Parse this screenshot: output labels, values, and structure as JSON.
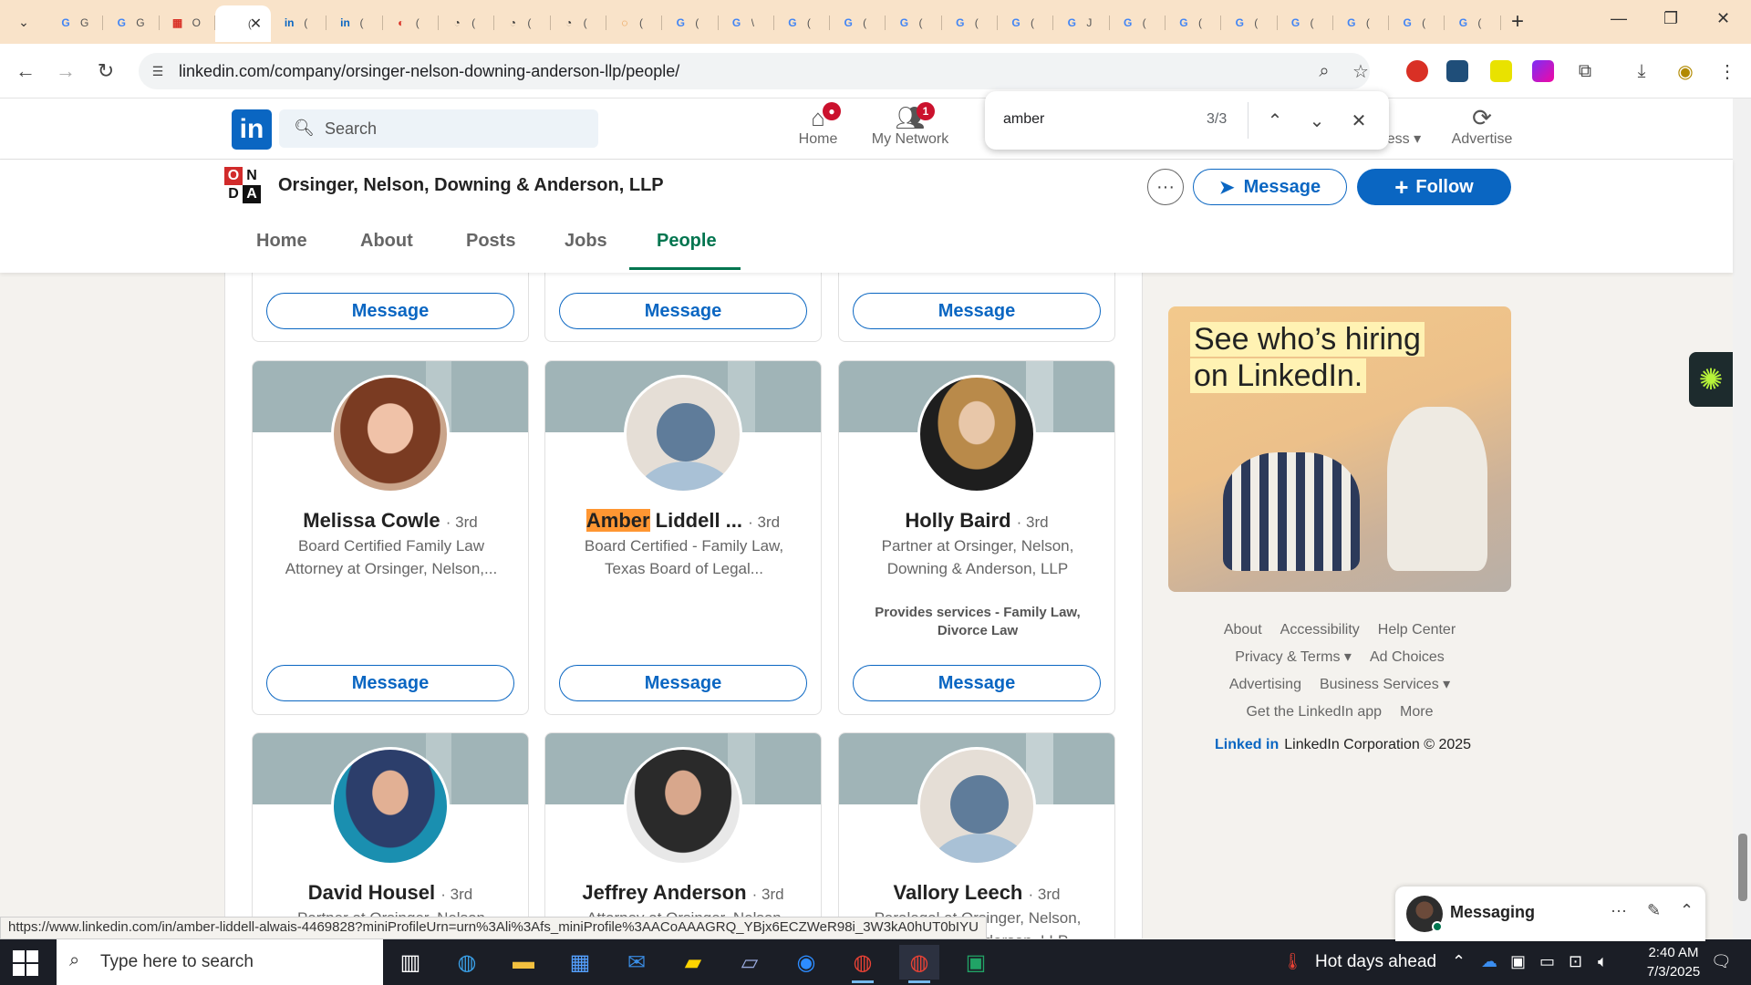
{
  "browser": {
    "tabs": [
      {
        "fav": "G",
        "color": "#4285f4",
        "label": "G"
      },
      {
        "fav": "G",
        "color": "#4285f4",
        "label": "G"
      },
      {
        "fav": "▦",
        "color": "#d93025",
        "label": "O"
      },
      {
        "fav": "",
        "color": "#888888",
        "label": "(",
        "active": true
      },
      {
        "fav": "in",
        "color": "#0a66c2",
        "label": "("
      },
      {
        "fav": "in",
        "color": "#0a66c2",
        "label": "("
      },
      {
        "fav": "◐",
        "color": "#d93025",
        "label": "("
      },
      {
        "fav": "◔",
        "color": "#333333",
        "label": "("
      },
      {
        "fav": "◔",
        "color": "#333333",
        "label": "("
      },
      {
        "fav": "◔",
        "color": "#333333",
        "label": "("
      },
      {
        "fav": "◌",
        "color": "#e37400",
        "label": "("
      },
      {
        "fav": "G",
        "color": "#4285f4",
        "label": "("
      },
      {
        "fav": "G",
        "color": "#4285f4",
        "label": "\\"
      },
      {
        "fav": "G",
        "color": "#4285f4",
        "label": "("
      },
      {
        "fav": "G",
        "color": "#4285f4",
        "label": "("
      },
      {
        "fav": "G",
        "color": "#4285f4",
        "label": "("
      },
      {
        "fav": "G",
        "color": "#4285f4",
        "label": "("
      },
      {
        "fav": "G",
        "color": "#4285f4",
        "label": "("
      },
      {
        "fav": "G",
        "color": "#4285f4",
        "label": "J"
      },
      {
        "fav": "G",
        "color": "#4285f4",
        "label": "("
      },
      {
        "fav": "G",
        "color": "#4285f4",
        "label": "("
      },
      {
        "fav": "G",
        "color": "#4285f4",
        "label": "("
      },
      {
        "fav": "G",
        "color": "#4285f4",
        "label": "("
      },
      {
        "fav": "G",
        "color": "#4285f4",
        "label": "("
      },
      {
        "fav": "G",
        "color": "#4285f4",
        "label": "("
      },
      {
        "fav": "G",
        "color": "#4285f4",
        "label": "("
      }
    ],
    "url": "linkedin.com/company/orsinger-nelson-downing-anderson-llp/people/"
  },
  "find": {
    "query": "amber",
    "count": "3/3"
  },
  "linkedin": {
    "logo": "in",
    "search_placeholder": "Search",
    "nav": [
      {
        "label": "Home",
        "icon": "⌂",
        "badge": "●"
      },
      {
        "label": "My Network",
        "icon": "👥",
        "badge": "1"
      }
    ],
    "nav_partial": [
      "ness ▾",
      "Advertise"
    ]
  },
  "company": {
    "logo_letters": [
      "O",
      "N",
      "D",
      "A"
    ],
    "name": "Orsinger, Nelson, Downing & Anderson, LLP",
    "message_label": "Message",
    "follow_label": "Follow",
    "tabs": [
      "Home",
      "About",
      "Posts",
      "Jobs",
      "People"
    ],
    "active_tab": "People"
  },
  "people": {
    "message_label": "Message",
    "top_row_messages": [
      "Message",
      "Message",
      "Message"
    ],
    "row1": [
      {
        "name": "Melissa Cowle",
        "degree": "· 3rd",
        "headline_1": "Board Certified Family Law",
        "headline_2": "Attorney at Orsinger, Nelson,...",
        "services": ""
      },
      {
        "name_hl": "Amber",
        "name_rest": " Liddell ...",
        "degree": "· 3rd",
        "headline_1": "Board Certified - Family Law,",
        "headline_2": "Texas Board of Legal...",
        "services": ""
      },
      {
        "name": "Holly Baird",
        "degree": "· 3rd",
        "headline_1": "Partner at Orsinger, Nelson,",
        "headline_2": "Downing & Anderson, LLP",
        "services": "Provides services - Family Law, Divorce Law"
      }
    ],
    "row2": [
      {
        "name": "David Housel",
        "degree": "· 3rd",
        "headline_1": "Partner at Orsinger, Nelson"
      },
      {
        "name": "Jeffrey Anderson",
        "degree": "· 3rd",
        "headline_1": "Attorney at Orsinger, Nelson"
      },
      {
        "name": "Vallory Leech",
        "degree": "· 3rd",
        "headline_1": "Paralegal at Orsinger, Nelson,",
        "headline_2": "Downing & Anderson, LLP"
      }
    ]
  },
  "rail": {
    "ad_line1": "See who’s hiring",
    "ad_line2": "on LinkedIn.",
    "footer_row1": [
      "About",
      "Accessibility",
      "Help Center"
    ],
    "footer_row2": [
      "Privacy & Terms ▾",
      "Ad Choices"
    ],
    "footer_row3": [
      "Advertising",
      "Business Services ▾"
    ],
    "footer_row4": [
      "Get the LinkedIn app",
      "More"
    ],
    "corp_mark": "Linked in",
    "corp_text": "LinkedIn Corporation © 2025"
  },
  "messaging": {
    "title": "Messaging"
  },
  "status_url": "https://www.linkedin.com/in/amber-liddell-alwais-4469828?miniProfileUrn=urn%3Ali%3Afs_miniProfile%3AACoAAAGRQ_YBjx6ECZWeR98i_3W3kA0hUT0bIYU",
  "taskbar": {
    "search_placeholder": "Type here to search",
    "weather": "Hot days ahead",
    "time": "2:40 AM",
    "date": "7/3/2025"
  },
  "colors": {
    "linkedin_blue": "#0a66c2",
    "people_green": "#01754f",
    "find_highlight": "#ff9632",
    "tab_strip": "#f9e3c9"
  }
}
